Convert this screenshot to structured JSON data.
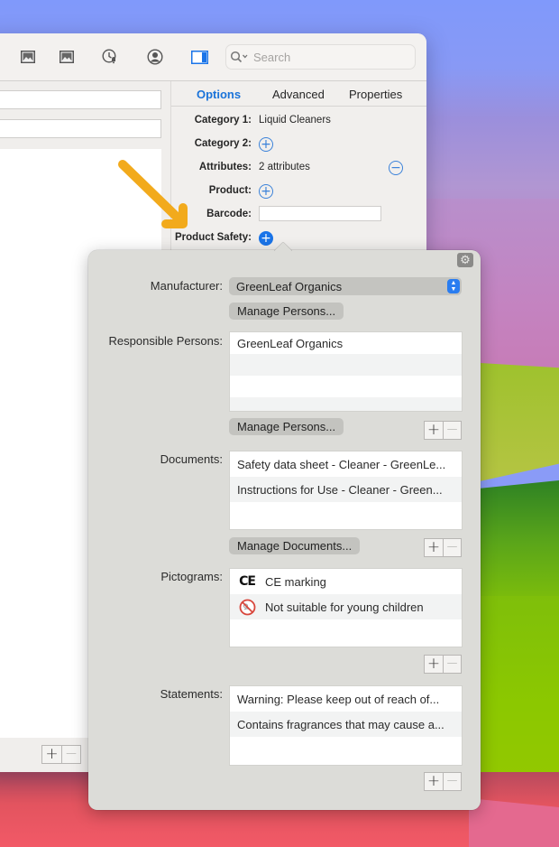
{
  "toolbar": {
    "icons": [
      "image-icon",
      "image-icon",
      "clock-alert-icon",
      "person-circle-icon",
      "sidebar-toggle-icon"
    ],
    "search": {
      "placeholder": "Search",
      "value": ""
    }
  },
  "left_pane": {
    "fields": [
      "",
      ""
    ],
    "add_label": "+",
    "remove_label": "−"
  },
  "inspector": {
    "tabs": [
      {
        "label": "Options",
        "active": true
      },
      {
        "label": "Advanced",
        "active": false
      },
      {
        "label": "Properties",
        "active": false
      }
    ],
    "rows": {
      "category1": {
        "label": "Category 1:",
        "value": "Liquid Cleaners"
      },
      "category2": {
        "label": "Category 2:",
        "button": "+"
      },
      "attributes": {
        "label": "Attributes:",
        "value": "2 attributes",
        "button": "−"
      },
      "product": {
        "label": "Product:",
        "button": "+"
      },
      "barcode": {
        "label": "Barcode:",
        "value": ""
      },
      "product_safety": {
        "label": "Product Safety:",
        "button": "+"
      }
    }
  },
  "annotation": {
    "arrow_color": "#f2aa1c"
  },
  "popover": {
    "gear_icon": "gear-icon",
    "manufacturer": {
      "label": "Manufacturer:",
      "selected": "GreenLeaf Organics",
      "manage_label": "Manage Persons..."
    },
    "responsible_persons": {
      "label": "Responsible Persons:",
      "items": [
        "GreenLeaf Organics"
      ],
      "manage_label": "Manage Persons...",
      "add_label": "+",
      "remove_label": "−"
    },
    "documents": {
      "label": "Documents:",
      "items": [
        "Safety data sheet - Cleaner - GreenLe...",
        "Instructions for Use - Cleaner - Green..."
      ],
      "manage_label": "Manage Documents...",
      "add_label": "+",
      "remove_label": "−"
    },
    "pictograms": {
      "label": "Pictograms:",
      "items": [
        {
          "icon": "ce-marking-icon",
          "glyph": "CE",
          "label": "CE marking"
        },
        {
          "icon": "not-for-children-icon",
          "glyph": "",
          "label": "Not suitable for young children"
        }
      ],
      "add_label": "+",
      "remove_label": "−"
    },
    "statements": {
      "label": "Statements:",
      "items": [
        "Warning: Please keep out of reach of...",
        "Contains fragrances that may cause a..."
      ],
      "add_label": "+",
      "remove_label": "−"
    }
  },
  "colors": {
    "accent": "#1a73d9",
    "popover_bg": "#dcdcd8",
    "window_bg": "#f1efed"
  }
}
